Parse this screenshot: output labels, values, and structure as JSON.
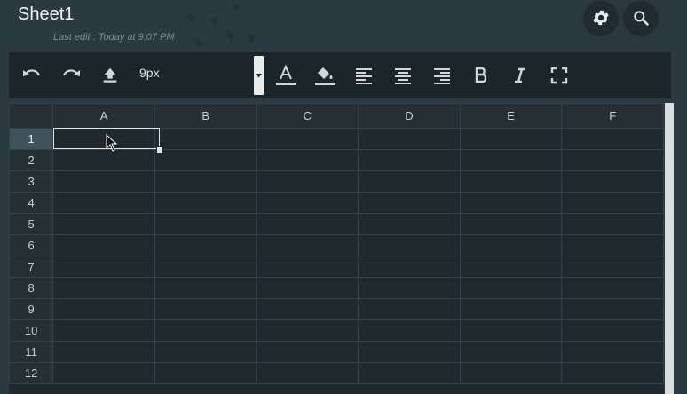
{
  "sheet": {
    "title": "Sheet1",
    "last_edit": "Last edit : Today at 9:07 PM"
  },
  "header_buttons": [
    {
      "name": "settings",
      "icon": "gear-icon"
    },
    {
      "name": "search",
      "icon": "search-icon"
    }
  ],
  "toolbar": {
    "font_size": "9px",
    "icons": [
      "undo-icon",
      "redo-icon",
      "upload-icon",
      "text-color-icon",
      "fill-color-icon",
      "align-left-icon",
      "align-center-icon",
      "align-right-icon",
      "bold-icon",
      "italic-icon",
      "fullscreen-icon"
    ]
  },
  "grid": {
    "columns": [
      "A",
      "B",
      "C",
      "D",
      "E",
      "F"
    ],
    "rows": [
      "1",
      "2",
      "3",
      "4",
      "5",
      "6",
      "7",
      "8",
      "9",
      "10",
      "11",
      "12"
    ],
    "active_cell": "A1"
  },
  "colors": {
    "background": "#2b3a41",
    "toolbar": "#1b252a",
    "grid": "#20292e",
    "active_header": "#3f535b"
  }
}
